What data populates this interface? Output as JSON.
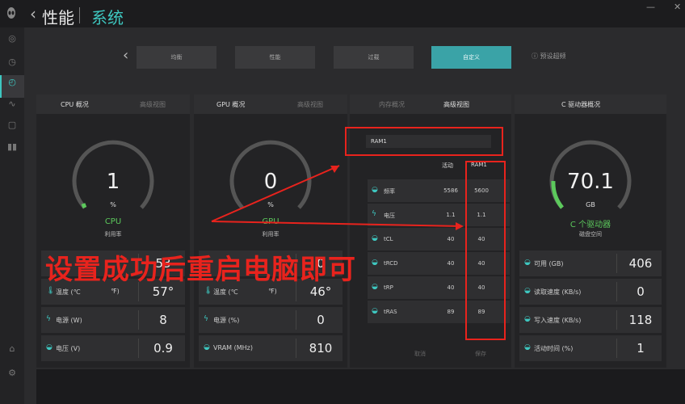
{
  "header": {
    "title": "性能",
    "subtitle": "系统"
  },
  "tabs": [
    "均衡",
    "性能",
    "过载",
    "自定义"
  ],
  "reset_label": "预设超频",
  "cpu": {
    "tab1": "CPU 概况",
    "tab2": "高级视图",
    "value": "1",
    "unit": "%",
    "name": "CPU",
    "sub": "利用率",
    "level": 0.01,
    "rows": [
      {
        "label": "温度 (℃",
        "toggle": "℉)",
        "value": "57°"
      },
      {
        "label": "电源 (W)",
        "value": "8"
      },
      {
        "label": "电压 (V)",
        "value": "0.9"
      }
    ],
    "row0_value": "53"
  },
  "gpu": {
    "tab1": "GPU 概况",
    "tab2": "高级视图",
    "value": "0",
    "unit": "%",
    "name": "GPU",
    "sub": "利用率",
    "level": 0,
    "rows": [
      {
        "label": "温度 (℃",
        "toggle": "℉)",
        "value": "46°"
      },
      {
        "label": "电源 (%)",
        "value": "0"
      },
      {
        "label": "VRAM (MHz)",
        "value": "810"
      }
    ],
    "row0_value": "0"
  },
  "ram": {
    "tab1": "内存概况",
    "tab2": "高级视图",
    "profile": "RAM1",
    "col1": "活动",
    "col2": "RAM1",
    "rows": [
      {
        "label": "频率",
        "v1": "5586",
        "v2": "5600"
      },
      {
        "label": "电压",
        "v1": "1.1",
        "v2": "1.1"
      },
      {
        "label": "tCL",
        "v1": "40",
        "v2": "40"
      },
      {
        "label": "tRCD",
        "v1": "40",
        "v2": "40"
      },
      {
        "label": "tRP",
        "v1": "40",
        "v2": "40"
      },
      {
        "label": "tRAS",
        "v1": "89",
        "v2": "89"
      }
    ],
    "cancel": "取消",
    "save": "保存"
  },
  "disk": {
    "tab1": "C 驱动器概况",
    "value": "70.1",
    "unit": "GB",
    "name": "C 个驱动器",
    "sub": "磁盘空间",
    "level": 0.15,
    "rows": [
      {
        "label": "可用 (GB)",
        "value": "406"
      },
      {
        "label": "读取速度 (KB/s)",
        "value": "0"
      },
      {
        "label": "写入速度 (KB/s)",
        "value": "118"
      },
      {
        "label": "活动时间 (%)",
        "value": "1"
      }
    ]
  },
  "overlay": "设置成功后重启电脑即可"
}
